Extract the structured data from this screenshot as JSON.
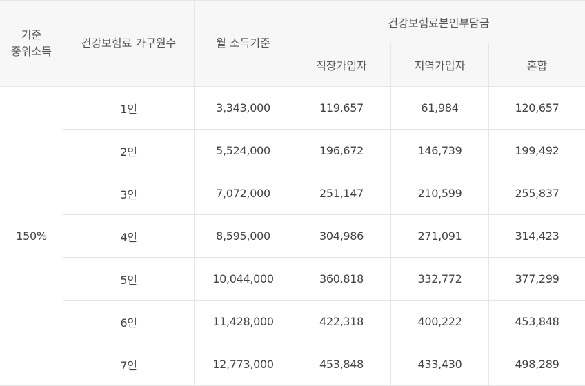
{
  "header": {
    "col1_line1": "기준",
    "col1_line2": "중위소득",
    "col2": "건강보험료 가구원수",
    "col3": "월 소득기준",
    "group": "건강보험료본인부담금",
    "sub1": "직장가입자",
    "sub2": "지역가입자",
    "sub3": "혼합"
  },
  "percent": "150%",
  "rows": [
    {
      "household": "1인",
      "income": "3,343,000",
      "workplace": "119,657",
      "regional": "61,984",
      "mixed": "120,657"
    },
    {
      "household": "2인",
      "income": "5,524,000",
      "workplace": "196,672",
      "regional": "146,739",
      "mixed": "199,492"
    },
    {
      "household": "3인",
      "income": "7,072,000",
      "workplace": "251,147",
      "regional": "210,599",
      "mixed": "255,837"
    },
    {
      "household": "4인",
      "income": "8,595,000",
      "workplace": "304,986",
      "regional": "271,091",
      "mixed": "314,423"
    },
    {
      "household": "5인",
      "income": "10,044,000",
      "workplace": "360,818",
      "regional": "332,772",
      "mixed": "377,299"
    },
    {
      "household": "6인",
      "income": "11,428,000",
      "workplace": "422,318",
      "regional": "400,222",
      "mixed": "453,848"
    },
    {
      "household": "7인",
      "income": "12,773,000",
      "workplace": "453,848",
      "regional": "433,430",
      "mixed": "498,289"
    }
  ]
}
